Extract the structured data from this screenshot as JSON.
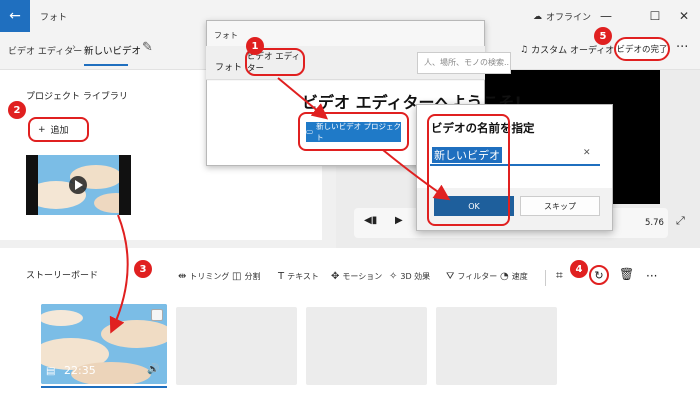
{
  "window": {
    "title": "フォト",
    "offline": "オフライン",
    "back_icon": "←",
    "minimize": "—",
    "maximize": "☐",
    "close": "✕"
  },
  "header": {
    "breadcrumb_root": "ビデオ エディター",
    "breadcrumb_sep": "›",
    "breadcrumb_current": "新しいビデオ",
    "custom_audio": "カスタム オーディオ",
    "finish_video": "ビデオの完了",
    "more": "···"
  },
  "library": {
    "title": "プロジェクト ライブラリ",
    "add": "追加"
  },
  "preview": {
    "time": "5.76"
  },
  "storyboard": {
    "title": "ストーリーボード",
    "tools": [
      "トリミング",
      "分割",
      "テキスト",
      "モーション",
      "3D 効果",
      "フィルター",
      "速度"
    ],
    "clip_duration": "22:35"
  },
  "dialog_main": {
    "title": "フォト",
    "tab_photo": "フォト",
    "tab_video": "ビデオ エディター",
    "search_placeholder": "人、場所、モノの検索...",
    "welcome": "ビデオ エディターへようこそ!",
    "new_project": "新しいビデオ プロジェクト"
  },
  "dialog_name": {
    "title": "ビデオの名前を指定",
    "value": "新しいビデオ",
    "ok": "OK",
    "skip": "スキップ"
  },
  "steps": [
    "1",
    "2",
    "3",
    "4",
    "5"
  ],
  "colors": {
    "accent": "#1f6fbf",
    "annotation_red": "#e02020"
  }
}
